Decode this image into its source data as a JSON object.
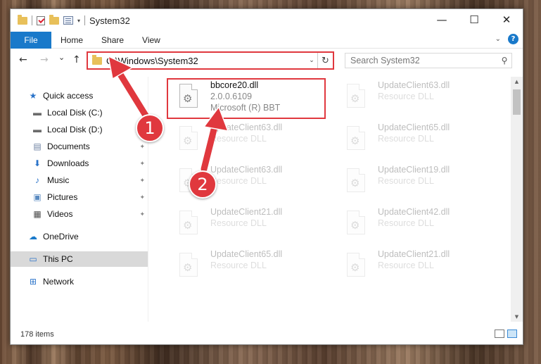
{
  "window": {
    "title": "System32",
    "controls": {
      "minimize": "—",
      "maximize": "☐",
      "close": "✕"
    }
  },
  "ribbon": {
    "file": "File",
    "tabs": [
      "Home",
      "Share",
      "View"
    ],
    "help": "?"
  },
  "nav": {
    "back": "←",
    "forward": "→",
    "recent": "⌄",
    "up": "↑",
    "address": "C:\\Windows\\System32",
    "address_dropdown": "⌄",
    "refresh": "↻",
    "search_placeholder": "Search System32",
    "search_glyph": "⚲"
  },
  "sidebar": {
    "items": [
      {
        "label": "Quick access",
        "icon": "★",
        "color": "#2a73c9"
      },
      {
        "label": "Local Disk (C:)",
        "icon": "▬",
        "color": "#6b6b6b"
      },
      {
        "label": "Local Disk (D:)",
        "icon": "▬",
        "color": "#6b6b6b"
      },
      {
        "label": "Documents",
        "icon": "▤",
        "color": "#6b7fa0"
      },
      {
        "label": "Downloads",
        "icon": "⬇",
        "color": "#2a73c9"
      },
      {
        "label": "Music",
        "icon": "♪",
        "color": "#2a73c9"
      },
      {
        "label": "Pictures",
        "icon": "▣",
        "color": "#5a8ac0"
      },
      {
        "label": "Videos",
        "icon": "▦",
        "color": "#4a4a4a"
      },
      {
        "label": "OneDrive",
        "icon": "☁",
        "color": "#1979ca"
      },
      {
        "label": "This PC",
        "icon": "▭",
        "color": "#2a73c9"
      },
      {
        "label": "Network",
        "icon": "⊞",
        "color": "#2a73c9"
      }
    ],
    "pin_glyph": "📌"
  },
  "files": {
    "highlighted": {
      "name": "bbcore20.dll",
      "version": "2.0.0.6109",
      "company": "Microsoft (R) BBT"
    },
    "faded": [
      {
        "name": "UpdateClient63.dll",
        "desc": "Resource DLL"
      },
      {
        "name": "UpdateClient63.dll",
        "desc": "Resource DLL"
      },
      {
        "name": "UpdateClient65.dll",
        "desc": "Resource DLL"
      },
      {
        "name": "UpdateClient63.dll",
        "desc": "Resource DLL"
      },
      {
        "name": "UpdateClient19.dll",
        "desc": "Resource DLL"
      },
      {
        "name": "UpdateClient21.dll",
        "desc": "Resource DLL"
      },
      {
        "name": "UpdateClient42.dll",
        "desc": "Resource DLL"
      },
      {
        "name": "UpdateClient65.dll",
        "desc": "Resource DLL"
      },
      {
        "name": "UpdateClient21.dll",
        "desc": "Resource DLL"
      }
    ],
    "gear_glyph": "⚙"
  },
  "status": {
    "item_count": "178 items"
  },
  "annotations": {
    "badge1": "1",
    "badge2": "2",
    "color": "#e0383e"
  }
}
